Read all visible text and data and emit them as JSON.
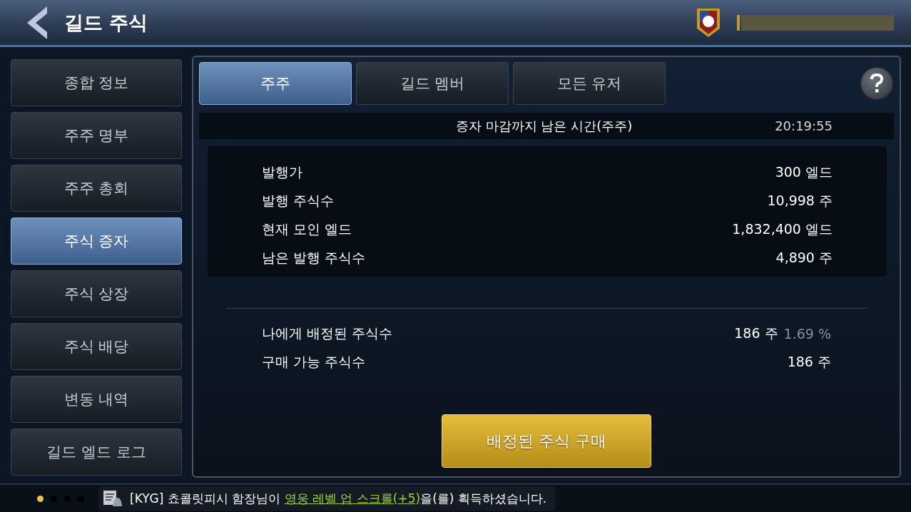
{
  "header": {
    "title": "길드 주식"
  },
  "sidebar": {
    "items": [
      {
        "label": "종합 정보",
        "selected": false
      },
      {
        "label": "주주 명부",
        "selected": false
      },
      {
        "label": "주주 총회",
        "selected": false
      },
      {
        "label": "주식 증자",
        "selected": true
      },
      {
        "label": "주식 상장",
        "selected": false
      },
      {
        "label": "주식 배당",
        "selected": false
      },
      {
        "label": "변동 내역",
        "selected": false
      },
      {
        "label": "길드 엘드 로그",
        "selected": false
      }
    ]
  },
  "tabs": [
    {
      "label": "주주",
      "selected": true
    },
    {
      "label": "길드 멤버",
      "selected": false
    },
    {
      "label": "모든 유저",
      "selected": false
    }
  ],
  "countdown": {
    "label": "증자 마감까지 남은 시간(주주)",
    "value": "20:19:55"
  },
  "stats": [
    {
      "label": "발행가",
      "value": "300 엘드"
    },
    {
      "label": "발행 주식수",
      "value": "10,998 주"
    },
    {
      "label": "현재 모인 엘드",
      "value": "1,832,400 엘드"
    },
    {
      "label": "남은 발행 주식수",
      "value": "4,890 주"
    }
  ],
  "allocation": [
    {
      "label": "나에게 배정된 주식수",
      "value": "186 주",
      "percent": "1.69 %"
    },
    {
      "label": "구매 가능 주식수",
      "value": "186 주"
    }
  ],
  "buy_button": "배정된 주식 구매",
  "ticker": {
    "pages": [
      {
        "selected": true
      },
      {
        "selected": false
      },
      {
        "selected": false
      },
      {
        "selected": false
      }
    ],
    "prefix": "[KYG] 쵸콜릿피시 함장님이 ",
    "link": "영웅 레벨 업 스크롤(+5)",
    "suffix": "을(를) 획득하셨습니다."
  }
}
